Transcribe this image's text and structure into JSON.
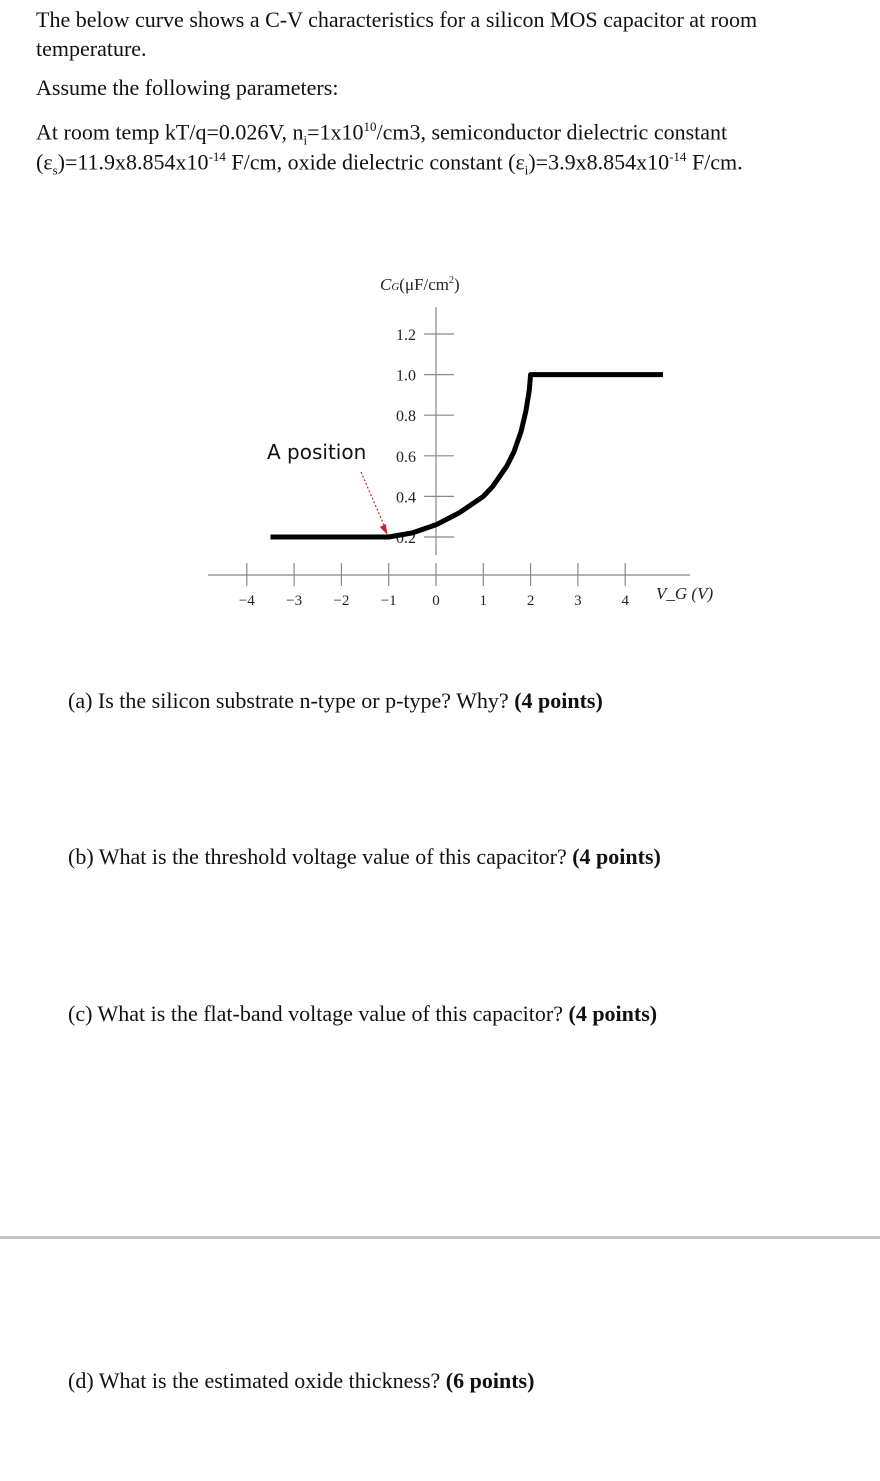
{
  "intro": {
    "line1": "The below curve shows a C-V characteristics for a silicon MOS capacitor at room",
    "line2": "temperature.",
    "assume": "Assume the following parameters:",
    "params_a": "At room temp kT/q=0.026V, n",
    "params_a_sub": "i",
    "params_a2": "=1x10",
    "params_a_sup": "10",
    "params_a3": "/cm3, semiconductor dielectric constant",
    "params_b1": "(ε",
    "params_b1_sub": "s",
    "params_b2": ")=11.9x8.854x10",
    "params_b2_sup": "-14",
    "params_b3": " F/cm, oxide dielectric constant (ε",
    "params_b3_sub": "i",
    "params_b4": ")=3.9x8.854x10",
    "params_b4_sup": "-14",
    "params_b5": " F/cm."
  },
  "chart_data": {
    "type": "line",
    "ylabel": "C_G (μF/cm²)",
    "xlabel": "V_G (V)",
    "x_ticks": [
      "-4",
      "-3",
      "-2",
      "-1",
      "0",
      "1",
      "2",
      "3",
      "4"
    ],
    "y_ticks": [
      "0.2",
      "0.4",
      "0.6",
      "0.8",
      "1.0",
      "1.2"
    ],
    "xlim": [
      -4.5,
      5
    ],
    "ylim": [
      0,
      1.3
    ],
    "series": [
      {
        "x": [
          -3.5,
          -1.0,
          -0.5,
          0.0,
          0.5,
          1.0,
          1.2,
          1.5,
          1.65,
          1.8,
          1.9,
          1.97,
          2.0,
          4.8
        ],
        "y": [
          0.2,
          0.2,
          0.22,
          0.26,
          0.32,
          0.4,
          0.45,
          0.55,
          0.62,
          0.72,
          0.82,
          0.92,
          1.0,
          1.0
        ],
        "color": "#000000"
      }
    ],
    "annotation": {
      "text": "A position",
      "x": -1.0,
      "y": 0.2,
      "arrow_color": "#d0202a"
    },
    "grid": false
  },
  "questions": {
    "a": "(a) Is the silicon substrate n-type or p-type? Why?",
    "a_points": "(4 points)",
    "b": "(b) What is the threshold voltage value of this capacitor?",
    "b_points": "(4 points)",
    "c": "(c) What is the flat-band voltage value of this capacitor?",
    "c_points": "(4 points)",
    "d": "(d) What is the estimated oxide thickness?",
    "d_points": "(6 points)"
  }
}
